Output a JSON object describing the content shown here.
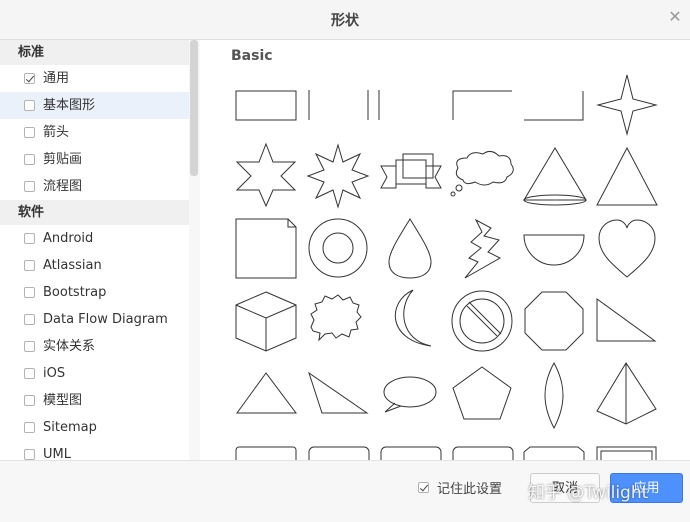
{
  "dialog": {
    "title": "形状",
    "close_icon": "close-icon"
  },
  "sidebar": {
    "sections": [
      {
        "heading": "标准",
        "items": [
          {
            "label": "通用",
            "checked": true
          },
          {
            "label": "基本图形",
            "checked": false,
            "active": true
          },
          {
            "label": "箭头",
            "checked": false
          },
          {
            "label": "剪贴画",
            "checked": false
          },
          {
            "label": "流程图",
            "checked": false
          }
        ]
      },
      {
        "heading": "软件",
        "items": [
          {
            "label": "Android",
            "checked": false
          },
          {
            "label": "Atlassian",
            "checked": false
          },
          {
            "label": "Bootstrap",
            "checked": false
          },
          {
            "label": "Data Flow Diagram",
            "checked": false
          },
          {
            "label": "实体关系",
            "checked": false
          },
          {
            "label": "iOS",
            "checked": false
          },
          {
            "label": "模型图",
            "checked": false
          },
          {
            "label": "Sitemap",
            "checked": false
          },
          {
            "label": "UML",
            "checked": false
          }
        ]
      }
    ]
  },
  "content": {
    "category_title": "Basic"
  },
  "footer": {
    "remember_label": "记住此设置",
    "remember_checked": true,
    "cancel_label": "取消",
    "apply_label": "应用",
    "watermark": "知乎 @Twilight"
  },
  "colors": {
    "accent": "#4d90fe",
    "active_row": "#eaf1fb",
    "stroke": "#333333"
  }
}
